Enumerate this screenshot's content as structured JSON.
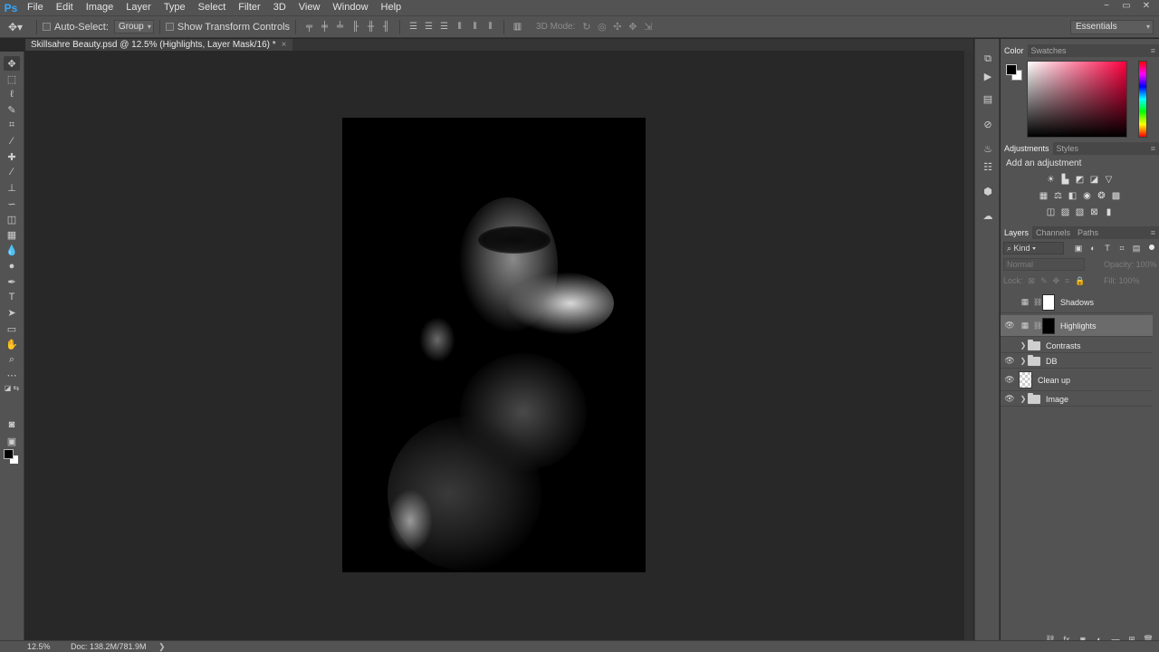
{
  "app": {
    "logo": "Ps"
  },
  "menu": [
    "File",
    "Edit",
    "Image",
    "Layer",
    "Type",
    "Select",
    "Filter",
    "3D",
    "View",
    "Window",
    "Help"
  ],
  "window_controls": [
    "−",
    "▭",
    "✕"
  ],
  "options": {
    "auto_select_label": "Auto-Select:",
    "auto_select_value": "Group",
    "show_transform_label": "Show Transform Controls",
    "mode3d_label": "3D Mode:",
    "workspace": "Essentials"
  },
  "document": {
    "tab_title": "Skillsahre Beauty.psd @ 12.5% (Highlights, Layer Mask/16) *",
    "close": "×"
  },
  "color_panel": {
    "tabs": [
      "Color",
      "Swatches"
    ],
    "foreground": "#000000",
    "background": "#ffffff"
  },
  "adjustments_panel": {
    "tabs": [
      "Adjustments",
      "Styles"
    ],
    "title": "Add an adjustment"
  },
  "layers_panel": {
    "tabs": [
      "Layers",
      "Channels",
      "Paths"
    ],
    "filter": "Kind",
    "blend_mode": "Normal",
    "opacity_label": "Opacity:",
    "opacity_value": "100%",
    "lock_label": "Lock:",
    "fill_label": "Fill:",
    "fill_value": "100%",
    "layers": [
      {
        "name": "Shadows",
        "visible": false,
        "kind": "adjustment",
        "mask": "white",
        "selected": false
      },
      {
        "name": "Highlights",
        "visible": true,
        "kind": "adjustment",
        "mask": "black",
        "selected": true
      },
      {
        "name": "Contrasts",
        "visible": false,
        "kind": "group",
        "selected": false
      },
      {
        "name": "DB",
        "visible": true,
        "kind": "group",
        "selected": false
      },
      {
        "name": "Clean up",
        "visible": true,
        "kind": "pixel",
        "selected": false
      },
      {
        "name": "Image",
        "visible": true,
        "kind": "group",
        "selected": false
      }
    ]
  },
  "status": {
    "zoom": "12.5%",
    "doc": "Doc: 138.2M/781.9M",
    "arrow": "❯"
  }
}
